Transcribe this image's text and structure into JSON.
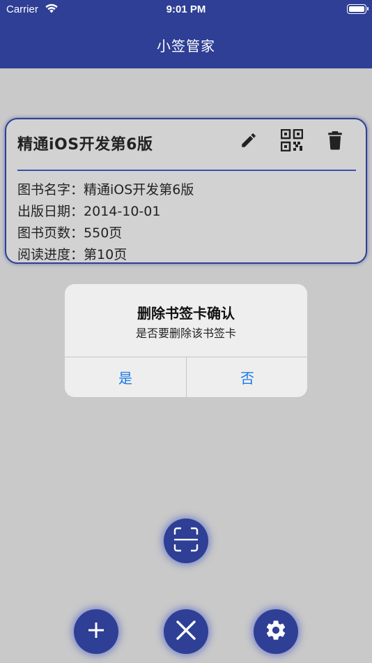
{
  "status_bar": {
    "carrier": "Carrier",
    "time": "9:01 PM"
  },
  "header": {
    "title": "小签管家"
  },
  "card": {
    "title": "精通iOS开发第6版",
    "rows": [
      {
        "label": "图书名字：",
        "value": "精通iOS开发第6版"
      },
      {
        "label": "出版日期：",
        "value": "2014-10-01"
      },
      {
        "label": "图书页数：",
        "value": "550页"
      },
      {
        "label": "阅读进度：",
        "value": "第10页"
      }
    ],
    "icons": [
      "edit-icon",
      "qr-code-icon",
      "trash-icon"
    ]
  },
  "dialog": {
    "title": "删除书签卡确认",
    "message": "是否要删除该书签卡",
    "yes_label": "是",
    "no_label": "否"
  },
  "fabs": [
    "scan-icon",
    "plus-icon",
    "close-icon",
    "gear-icon"
  ],
  "colors": {
    "primary": "#2e3f95",
    "background": "#c9c9c9",
    "dialog_button": "#1a7ae8"
  }
}
